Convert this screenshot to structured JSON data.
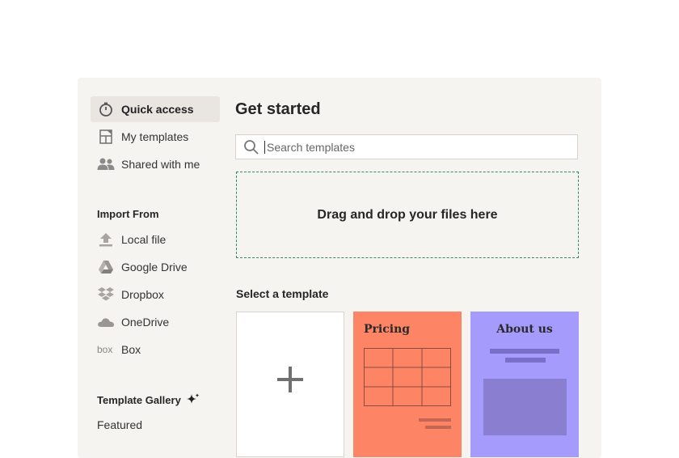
{
  "sidebar": {
    "items": [
      {
        "label": "Quick access",
        "icon": "timer-icon"
      },
      {
        "label": "My templates",
        "icon": "template-icon"
      },
      {
        "label": "Shared with me",
        "icon": "people-icon"
      }
    ],
    "import_heading": "Import From",
    "imports": [
      {
        "label": "Local file",
        "icon": "upload-icon"
      },
      {
        "label": "Google Drive",
        "icon": "google-drive-icon"
      },
      {
        "label": "Dropbox",
        "icon": "dropbox-icon"
      },
      {
        "label": "OneDrive",
        "icon": "onedrive-icon"
      },
      {
        "label": "Box",
        "icon": "box-icon"
      }
    ],
    "gallery_heading": "Template Gallery",
    "gallery_items": [
      "Featured"
    ]
  },
  "main": {
    "title": "Get started",
    "search_placeholder": "Search templates",
    "dropzone_text": "Drag and drop your files here",
    "templates_heading": "Select a template",
    "templates": [
      {
        "title": "",
        "kind": "blank"
      },
      {
        "title": "Pricing",
        "kind": "pricing"
      },
      {
        "title": "About us",
        "kind": "about"
      }
    ]
  },
  "colors": {
    "panel_bg": "#f6f4f1",
    "pricing_card": "#fe8466",
    "about_card": "#a59bfc",
    "dropzone_border": "#3a8a5a"
  }
}
